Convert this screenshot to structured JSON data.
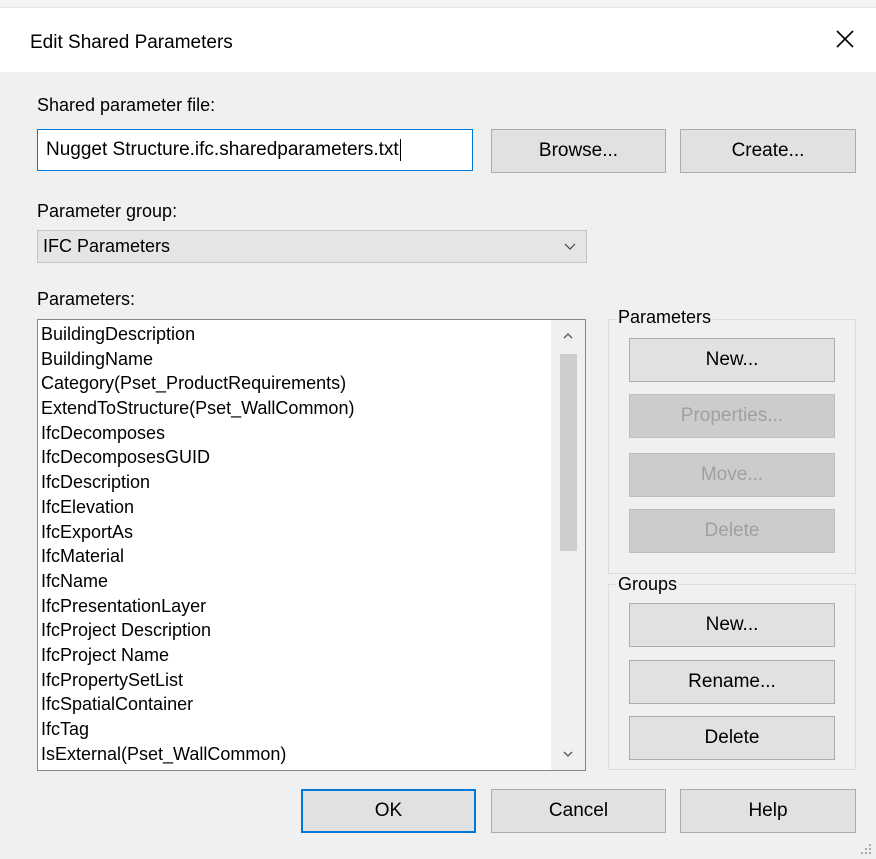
{
  "dialog": {
    "title": "Edit Shared Parameters",
    "close_icon": "close-icon"
  },
  "shared_file": {
    "label": "Shared parameter file:",
    "value": "Nugget Structure.ifc.sharedparameters.txt",
    "browse_label": "Browse...",
    "create_label": "Create..."
  },
  "param_group": {
    "label": "Parameter group:",
    "selected": "IFC Parameters"
  },
  "parameters": {
    "label": "Parameters:",
    "items": [
      "BuildingDescription",
      "BuildingName",
      "Category(Pset_ProductRequirements)",
      "ExtendToStructure(Pset_WallCommon)",
      "IfcDecomposes",
      "IfcDecomposesGUID",
      "IfcDescription",
      "IfcElevation",
      "IfcExportAs",
      "IfcMaterial",
      "IfcName",
      "IfcPresentationLayer",
      "IfcProject Description",
      "IfcProject Name",
      "IfcPropertySetList",
      "IfcSpatialContainer",
      "IfcTag",
      "IsExternal(Pset_WallCommon)"
    ]
  },
  "parameters_group": {
    "title": "Parameters",
    "new_label": "New...",
    "properties_label": "Properties...",
    "move_label": "Move...",
    "delete_label": "Delete"
  },
  "groups_group": {
    "title": "Groups",
    "new_label": "New...",
    "rename_label": "Rename...",
    "delete_label": "Delete"
  },
  "footer": {
    "ok_label": "OK",
    "cancel_label": "Cancel",
    "help_label": "Help"
  },
  "colors": {
    "focus_accent": "#0078d7",
    "dialog_bg": "#f0f0f0",
    "button_bg": "#e1e1e1",
    "disabled_text": "#a0a0a0"
  }
}
